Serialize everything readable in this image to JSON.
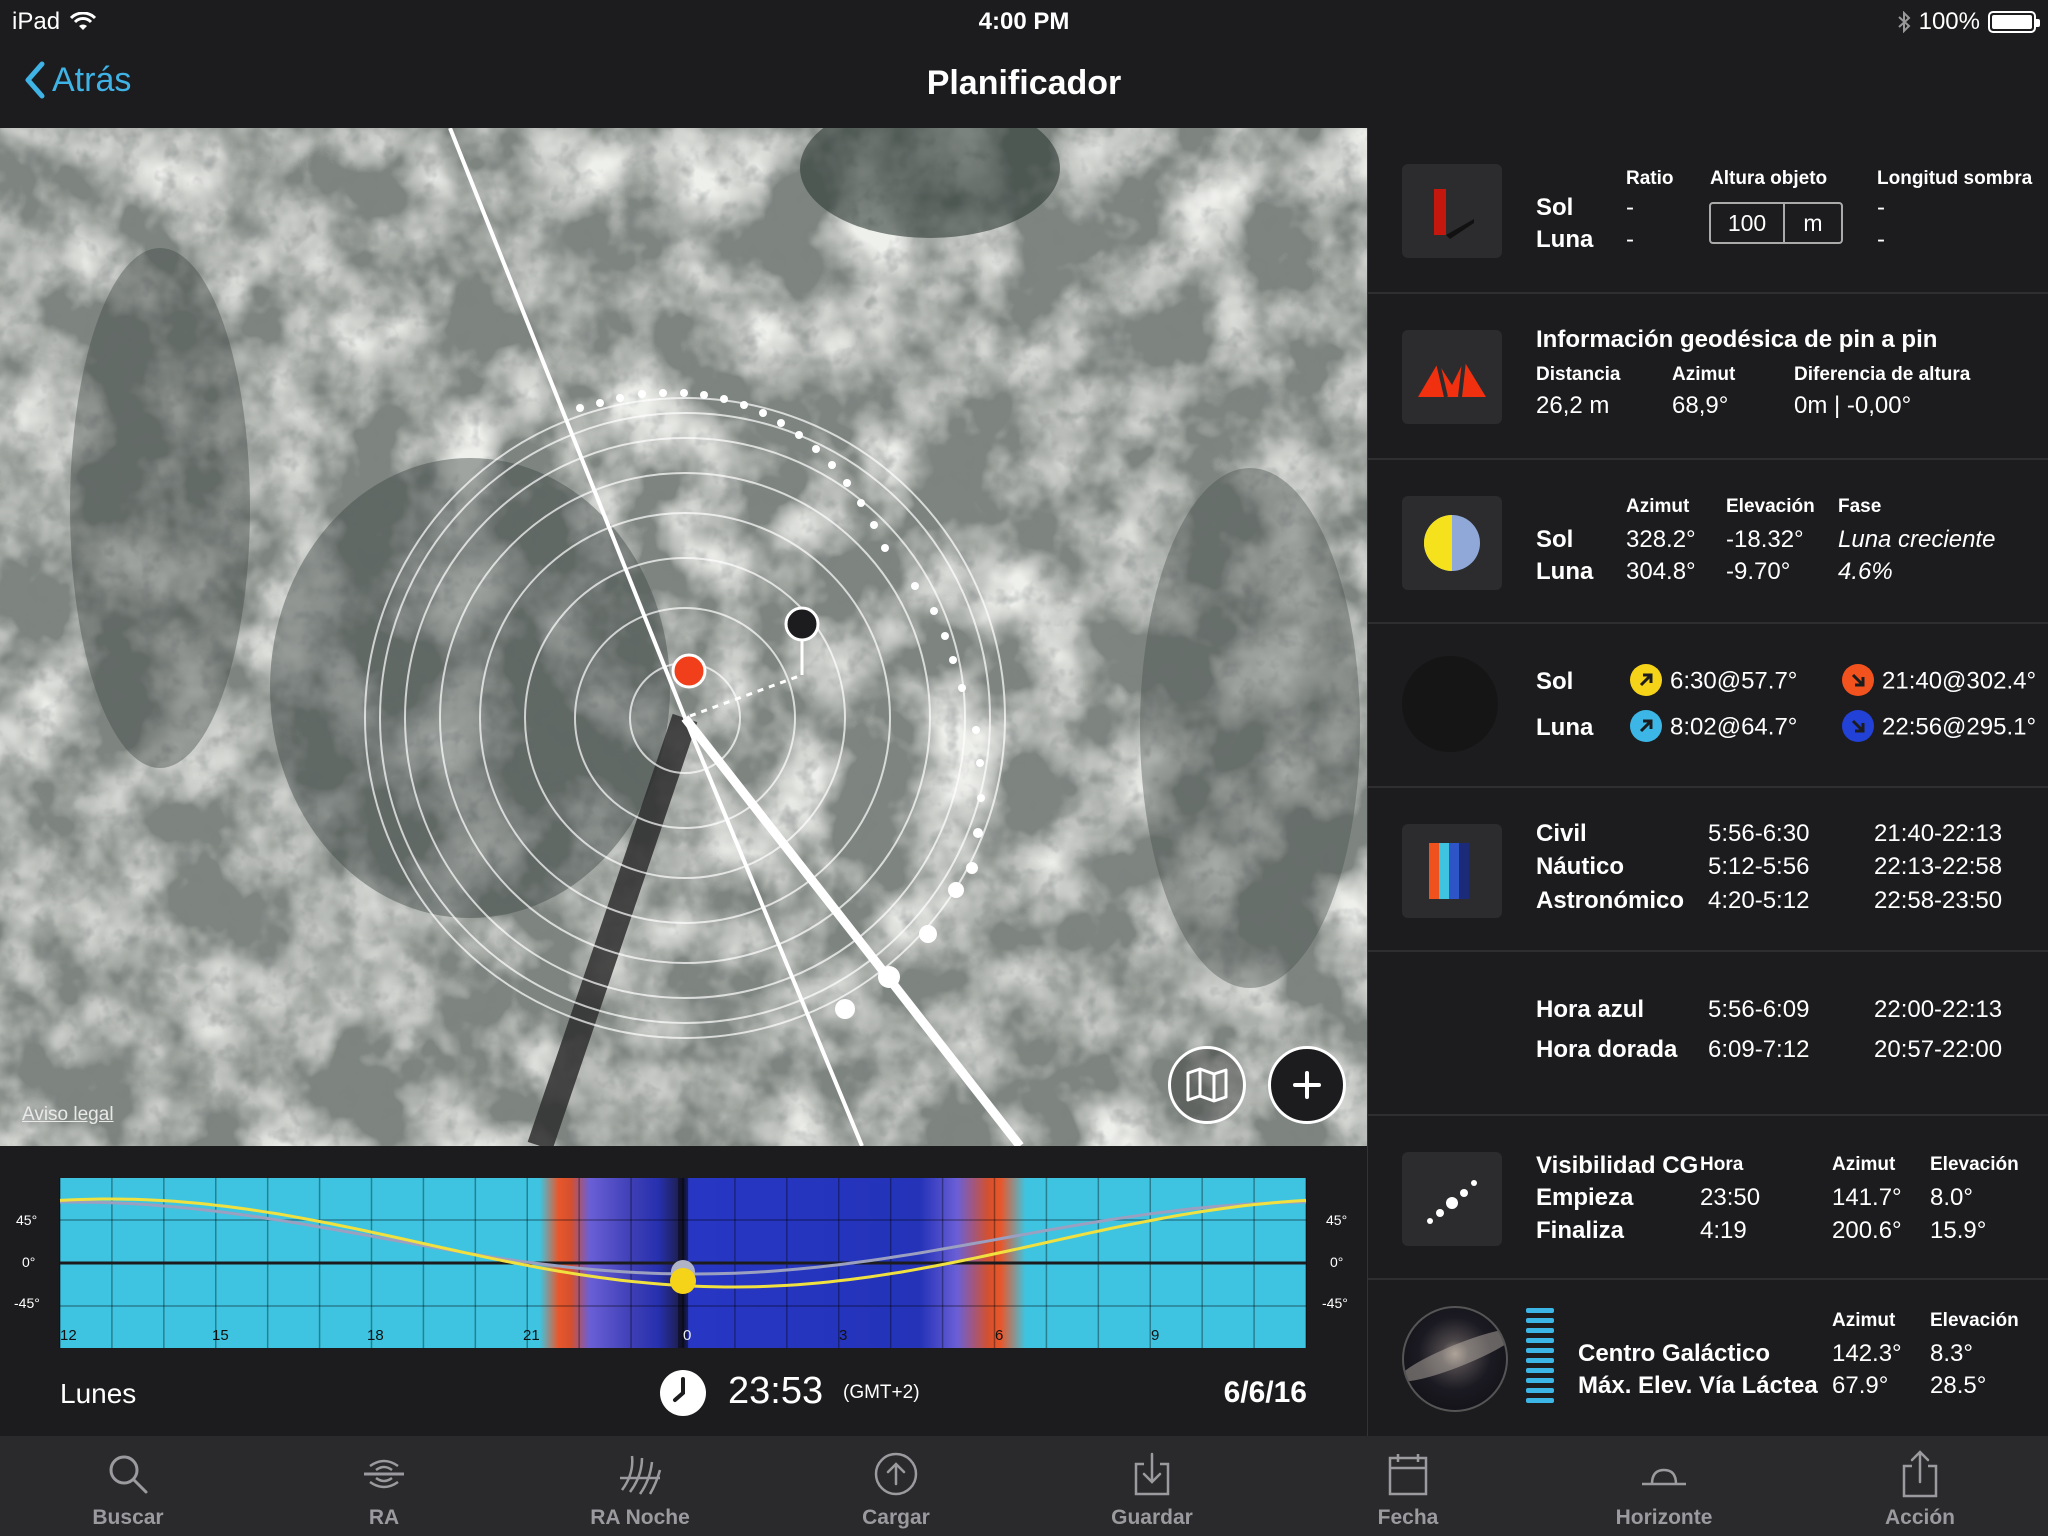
{
  "status_bar": {
    "device": "iPad",
    "time": "4:00 PM",
    "battery": "100%"
  },
  "nav": {
    "back_label": "Atrás",
    "title": "Planificador"
  },
  "map": {
    "legal_label": "Aviso legal"
  },
  "timeline": {
    "y_ticks_left": [
      "45°",
      "0°",
      "-45°"
    ],
    "y_ticks_right": [
      "45°",
      "0°",
      "-45°"
    ],
    "hour_labels": [
      "12",
      "15",
      "18",
      "21",
      "0",
      "3",
      "6",
      "9"
    ],
    "day": "Lunes",
    "time": "23:53",
    "timezone": "(GMT+2)",
    "date": "6/6/16"
  },
  "panel": {
    "shadow": {
      "sun_label": "Sol",
      "moon_label": "Luna",
      "ratio_header": "Ratio",
      "ratio_sun": "-",
      "ratio_moon": "-",
      "height_header": "Altura objeto",
      "height_value": "100",
      "height_unit": "m",
      "shadow_header": "Longitud sombra",
      "shadow_sun": "-",
      "shadow_moon": "-"
    },
    "geodesic": {
      "title": "Información geodésica de pin a pin",
      "distance_header": "Distancia",
      "distance_value": "26,2 m",
      "azimuth_header": "Azimut",
      "azimuth_value": "68,9°",
      "height_diff_header": "Diferencia de altura",
      "height_diff_value": "0m | -0,00°"
    },
    "position": {
      "sun_label": "Sol",
      "moon_label": "Luna",
      "azimuth_header": "Azimut",
      "elevation_header": "Elevación",
      "phase_header": "Fase",
      "sun_azimuth": "328.2°",
      "sun_elevation": "-18.32°",
      "moon_azimuth": "304.8°",
      "moon_elevation": "-9.70°",
      "phase_name": "Luna creciente",
      "phase_percent": "4.6%"
    },
    "rise_set": {
      "sun_label": "Sol",
      "moon_label": "Luna",
      "sun_rise": "6:30@57.7°",
      "sun_set": "21:40@302.4°",
      "moon_rise": "8:02@64.7°",
      "moon_set": "22:56@295.1°",
      "colors": {
        "sun_rise": "#f5d319",
        "sun_set": "#f2521d",
        "moon_rise": "#3bb6e6",
        "moon_set": "#2241d6"
      }
    },
    "twilight": {
      "civil_label": "Civil",
      "civil_morning": "5:56-6:30",
      "civil_evening": "21:40-22:13",
      "nautical_label": "Náutico",
      "nautical_morning": "5:12-5:56",
      "nautical_evening": "22:13-22:58",
      "astro_label": "Astronómico",
      "astro_morning": "4:20-5:12",
      "astro_evening": "22:58-23:50"
    },
    "hours": {
      "blue_label": "Hora azul",
      "blue_morning": "5:56-6:09",
      "blue_evening": "22:00-22:13",
      "golden_label": "Hora dorada",
      "golden_morning": "6:09-7:12",
      "golden_evening": "20:57-22:00"
    },
    "gc_visibility": {
      "title": "Visibilidad CG",
      "hour_header": "Hora",
      "azimuth_header": "Azimut",
      "elevation_header": "Elevación",
      "start_label": "Empieza",
      "start_time": "23:50",
      "start_azimuth": "141.7°",
      "start_elevation": "8.0°",
      "end_label": "Finaliza",
      "end_time": "4:19",
      "end_azimuth": "200.6°",
      "end_elevation": "15.9°"
    },
    "galactic_center": {
      "azimuth_header": "Azimut",
      "elevation_header": "Elevación",
      "center_label": "Centro Galáctico",
      "center_azimuth": "142.3°",
      "center_elevation": "8.3°",
      "max_label": "Máx. Elev. Vía Láctea",
      "max_azimuth": "67.9°",
      "max_elevation": "28.5°"
    }
  },
  "tabs": [
    {
      "label": "Buscar",
      "icon": "search-icon"
    },
    {
      "label": "RA",
      "icon": "ar-icon"
    },
    {
      "label": "RA Noche",
      "icon": "ar-night-icon"
    },
    {
      "label": "Cargar",
      "icon": "upload-icon"
    },
    {
      "label": "Guardar",
      "icon": "download-icon"
    },
    {
      "label": "Fecha",
      "icon": "calendar-icon"
    },
    {
      "label": "Horizonte",
      "icon": "horizon-icon"
    },
    {
      "label": "Acción",
      "icon": "share-icon"
    }
  ]
}
